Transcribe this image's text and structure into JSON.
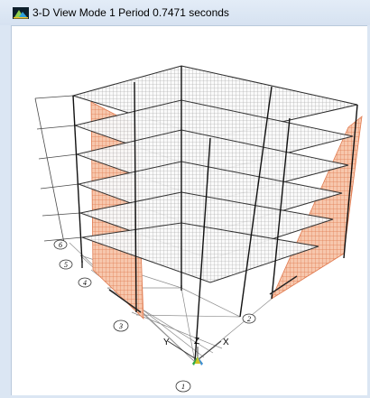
{
  "window": {
    "title": "3-D View  Mode 1  Period 0.7471 seconds",
    "icon": "etabs-app-icon"
  },
  "viewport": {
    "view": "3-D View",
    "mode": "Mode 1",
    "period_seconds": 0.7471,
    "grid_bubbles": [
      "6",
      "5",
      "4",
      "3",
      "2",
      "1"
    ],
    "axis_labels": {
      "x": "X",
      "y": "Y",
      "z": "Z"
    }
  },
  "colors": {
    "frame": "#1a1a1a",
    "slab_mesh": "#8a8a8a",
    "shear_wall": "#e8926a",
    "background": "#ffffff",
    "titlebar": "#d9e4f2",
    "axis_x": "#3a8dd8",
    "axis_y": "#27a84a",
    "axis_z": "#d0c225"
  }
}
